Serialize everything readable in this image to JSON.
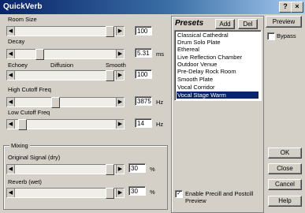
{
  "window": {
    "title": "QuickVerb",
    "help_btn": "?",
    "close_btn": "×"
  },
  "params": [
    {
      "label": "Room Size",
      "value": "100",
      "unit": ""
    },
    {
      "label": "Decay",
      "value": "5.31",
      "unit": "ms"
    },
    {
      "label": "Diffusion",
      "value": "100",
      "unit": ""
    },
    {
      "label": "High Cutoff Freq",
      "value": "3875",
      "unit": "Hz"
    },
    {
      "label": "Low Cutoff Freq",
      "value": "14",
      "unit": "Hz"
    }
  ],
  "diffusion_labels": {
    "left": "Echoey",
    "center": "Diffusion",
    "right": "Smooth"
  },
  "mixing": {
    "group_label": "Mixing",
    "original": {
      "label": "Original Signal (dry)",
      "value": "30",
      "unit": "%"
    },
    "reverb": {
      "label": "Reverb (wet)",
      "value": "30",
      "unit": "%"
    }
  },
  "presets": {
    "header": "Presets",
    "add_btn": "Add",
    "del_btn": "Del",
    "items": [
      "Classical Cathedral",
      "Drum Solo Plate",
      "Ethereal",
      "Live Reflection Chamber",
      "Outdoor Venue",
      "Pre-Delay Rock Room",
      "Smooth Plate",
      "Vocal Corridor",
      "Vocal Stage Warm"
    ],
    "selected_index": 8,
    "enable_label_1": "Enable Precill and Postcill",
    "enable_label_2": "Preview",
    "enable_checked": true
  },
  "right_buttons": {
    "preview": "Preview",
    "bypass": "Bypass",
    "ok": "OK",
    "close": "Close",
    "cancel": "Cancel",
    "help": "Help"
  }
}
